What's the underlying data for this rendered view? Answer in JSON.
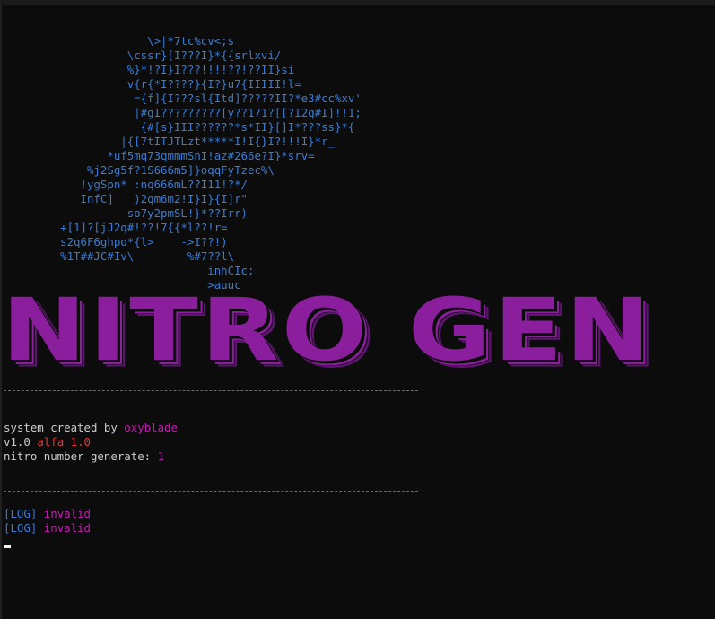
{
  "colors": {
    "background": "#0c0c0c",
    "text": "#cccccc",
    "accent_magenta": "#c01fae",
    "accent_purple": "#8b1e9c",
    "accent_red": "#e03a3a",
    "accent_blue": "#3a7bd5"
  },
  "ascii_art": [
    "                      \\>|*7tc%cv<;s",
    "                   \\cssr}[I???I}*{{srlxvi/",
    "                   %}*!?I}I???!!!!??!??II}si",
    "                   v{r{*I????}{I?}u7{IIIII!l=",
    "                    ={f]{I???sl{Itd]?????II?*e3#cc%xv'",
    "                    |#gI?????????[y??171?[[?I2q#I]!!1;",
    "                     {#[s}III??????*s*II}[]I*???ss}*{",
    "                  |{[7tITJTLzt*****I!I{}I?!!!I}*r_",
    "                *uf5mq73qmmmSnI!az#266e?I}*srv=",
    "             %j2Sg5f?1S666m5]}oqqFyTzec%\\",
    "            !ygSpn* :nq666mL??I11!?*/",
    "            InfC]   )2qm6m2!I}I}{I]r\"",
    "                   so7y2pmSL!}*??Irr)",
    "         +[1]?[jJ2q#!??!7{{*l??!r=",
    "         s2q6F6ghpo*{l>    ->I??!)",
    "         %1T##JC#Iv\\        %#7??l\\",
    "                               inhCIc;",
    "                               >auuc"
  ],
  "banner": {
    "title": "NITRO GEN"
  },
  "info": {
    "created_prefix": "system created by ",
    "author": "oxyblade",
    "version_prefix": "v1.0 ",
    "version_channel": "alfa 1.0",
    "generate_prefix": "nitro number generate: ",
    "generate_count": "1"
  },
  "logs": [
    {
      "tag": "[LOG]",
      "message": "invalid"
    },
    {
      "tag": "[LOG]",
      "message": "invalid"
    }
  ]
}
